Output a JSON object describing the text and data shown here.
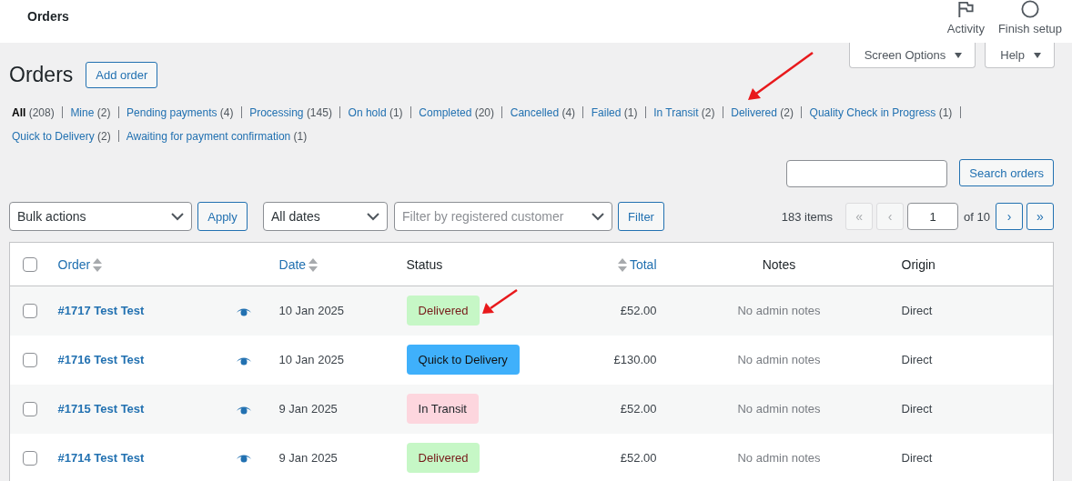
{
  "header": {
    "title": "Orders",
    "actions": [
      {
        "label": "Activity"
      },
      {
        "label": "Finish setup"
      }
    ]
  },
  "screen_tabs": [
    {
      "label": "Screen Options"
    },
    {
      "label": "Help"
    }
  ],
  "page": {
    "title": "Orders",
    "add_button": "Add order"
  },
  "filters": [
    {
      "label": "All",
      "count": "(208)",
      "selected": true
    },
    {
      "label": "Mine",
      "count": "(2)",
      "selected": false
    },
    {
      "label": "Pending payments",
      "count": "(4)",
      "selected": false
    },
    {
      "label": "Processing",
      "count": "(145)",
      "selected": false
    },
    {
      "label": "On hold",
      "count": "(1)",
      "selected": false
    },
    {
      "label": "Completed",
      "count": "(20)",
      "selected": false
    },
    {
      "label": "Cancelled",
      "count": "(4)",
      "selected": false
    },
    {
      "label": "Failed",
      "count": "(1)",
      "selected": false
    },
    {
      "label": "In Transit",
      "count": "(2)",
      "selected": false
    },
    {
      "label": "Delivered",
      "count": "(2)",
      "selected": false
    },
    {
      "label": "Quality Check in Progress",
      "count": "(1)",
      "selected": false
    },
    {
      "label": "Quick to Delivery",
      "count": "(2)",
      "selected": false
    },
    {
      "label": "Awaiting for payment confirmation",
      "count": "(1)",
      "selected": false
    }
  ],
  "search": {
    "button": "Search orders"
  },
  "toolbar": {
    "bulk_actions": "Bulk actions",
    "apply": "Apply",
    "date_filter": "All dates",
    "customer_filter": {
      "placeholder": "Filter by registered customer"
    },
    "filter_button": "Filter"
  },
  "pagination": {
    "count": "183 items",
    "first": {
      "label": "«",
      "disabled": true
    },
    "prev": {
      "label": "‹",
      "disabled": true
    },
    "page": "1",
    "of": "of 10",
    "next": {
      "label": "›",
      "disabled": false
    },
    "last": {
      "label": "»",
      "disabled": false
    }
  },
  "table": {
    "select_all": {
      "checked": false
    },
    "columns": [
      {
        "label": "Order",
        "sortable": true
      },
      {
        "label": "Date",
        "sortable": true
      },
      {
        "label": "Status",
        "sortable": false
      },
      {
        "label": "Total",
        "sortable": true
      },
      {
        "label": "Notes",
        "sortable": false
      },
      {
        "label": "Origin",
        "sortable": false
      }
    ],
    "rows": [
      {
        "checked": false,
        "order": "#1717 Test Test",
        "date": "10 Jan 2025",
        "status": {
          "label": "Delivered",
          "kind": "delivered"
        },
        "total": "£52.00",
        "notes": "No admin notes",
        "origin": "Direct"
      },
      {
        "checked": false,
        "order": "#1716 Test Test",
        "date": "10 Jan 2025",
        "status": {
          "label": "Quick to Delivery",
          "kind": "quick"
        },
        "total": "£130.00",
        "notes": "No admin notes",
        "origin": "Direct"
      },
      {
        "checked": false,
        "order": "#1715 Test Test",
        "date": "9 Jan 2025",
        "status": {
          "label": "In Transit",
          "kind": "transit"
        },
        "total": "£52.00",
        "notes": "No admin notes",
        "origin": "Direct"
      },
      {
        "checked": false,
        "order": "#1714 Test Test",
        "date": "9 Jan 2025",
        "status": {
          "label": "Delivered",
          "kind": "delivered"
        },
        "total": "£52.00",
        "notes": "No admin notes",
        "origin": "Direct"
      }
    ]
  }
}
